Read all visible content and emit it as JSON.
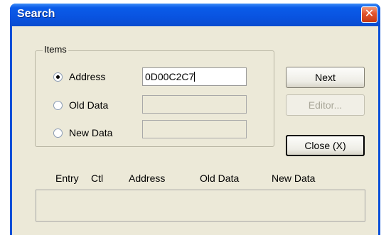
{
  "window": {
    "title": "Search",
    "close_glyph": "✕"
  },
  "items_group": {
    "label": "Items",
    "options": [
      {
        "label": "Address",
        "checked": true,
        "value": "0D00C2C7"
      },
      {
        "label": "Old Data",
        "checked": false,
        "value": ""
      },
      {
        "label": "New Data",
        "checked": false,
        "value": ""
      }
    ]
  },
  "buttons": {
    "next": "Next",
    "editor": "Editor...",
    "close": "Close (X)"
  },
  "results": {
    "columns": [
      "Entry",
      "Ctl",
      "Address",
      "Old Data",
      "New Data"
    ]
  },
  "colors": {
    "titlebar": "#0a4fd8",
    "client": "#ece9d8",
    "close_button": "#e0522b"
  },
  "icons": {
    "close": "close-icon"
  }
}
